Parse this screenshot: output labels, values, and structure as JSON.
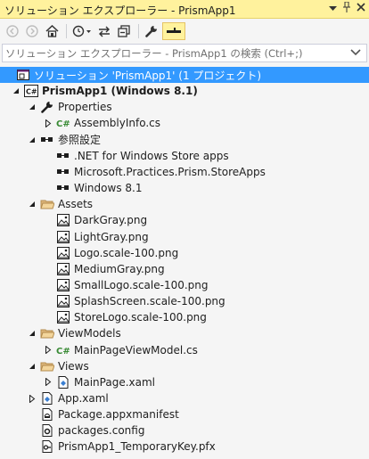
{
  "window": {
    "title": "ソリューション エクスプローラー - PrismApp1",
    "controls": [
      "dropdown-icon",
      "pin-icon",
      "close-icon"
    ]
  },
  "toolbar": {
    "buttons": [
      {
        "name": "back-button",
        "icon": "back-icon",
        "enabled": false
      },
      {
        "name": "forward-button",
        "icon": "forward-icon",
        "enabled": false
      },
      {
        "name": "home-button",
        "icon": "home-icon",
        "enabled": true
      },
      {
        "name": "history-button",
        "icon": "history-icon",
        "enabled": true
      },
      {
        "name": "sync-button",
        "icon": "sync-icon",
        "enabled": true
      },
      {
        "name": "collapse-all-button",
        "icon": "collapse-icon",
        "enabled": true
      },
      {
        "name": "properties-button",
        "icon": "wrench-icon",
        "enabled": true
      },
      {
        "name": "preview-button",
        "icon": "preview-icon",
        "enabled": true,
        "active": true
      }
    ]
  },
  "search": {
    "placeholder": "ソリューション エクスプローラー - PrismApp1 の検索 (Ctrl+;)"
  },
  "tree": [
    {
      "label": "ソリューション 'PrismApp1' (1 プロジェクト)",
      "icon": "solution-icon",
      "level": 0,
      "expander": "none",
      "selected": true
    },
    {
      "label": "PrismApp1 (Windows 8.1)",
      "icon": "csharp-project-icon",
      "level": 1,
      "expander": "open",
      "bold": true
    },
    {
      "label": "Properties",
      "icon": "wrench-icon",
      "level": 2,
      "expander": "open"
    },
    {
      "label": "AssemblyInfo.cs",
      "icon": "csharp-file-icon",
      "level": 3,
      "expander": "closed"
    },
    {
      "label": "参照設定",
      "icon": "references-icon",
      "level": 2,
      "expander": "open"
    },
    {
      "label": ".NET for Windows Store apps",
      "icon": "reference-icon",
      "level": 3,
      "expander": "none"
    },
    {
      "label": "Microsoft.Practices.Prism.StoreApps",
      "icon": "reference-icon",
      "level": 3,
      "expander": "none"
    },
    {
      "label": "Windows 8.1",
      "icon": "reference-icon",
      "level": 3,
      "expander": "none"
    },
    {
      "label": "Assets",
      "icon": "folder-open-icon",
      "level": 2,
      "expander": "open"
    },
    {
      "label": "DarkGray.png",
      "icon": "image-file-icon",
      "level": 3,
      "expander": "none"
    },
    {
      "label": "LightGray.png",
      "icon": "image-file-icon",
      "level": 3,
      "expander": "none"
    },
    {
      "label": "Logo.scale-100.png",
      "icon": "image-file-icon",
      "level": 3,
      "expander": "none"
    },
    {
      "label": "MediumGray.png",
      "icon": "image-file-icon",
      "level": 3,
      "expander": "none"
    },
    {
      "label": "SmallLogo.scale-100.png",
      "icon": "image-file-icon",
      "level": 3,
      "expander": "none"
    },
    {
      "label": "SplashScreen.scale-100.png",
      "icon": "image-file-icon",
      "level": 3,
      "expander": "none"
    },
    {
      "label": "StoreLogo.scale-100.png",
      "icon": "image-file-icon",
      "level": 3,
      "expander": "none"
    },
    {
      "label": "ViewModels",
      "icon": "folder-open-icon",
      "level": 2,
      "expander": "open"
    },
    {
      "label": "MainPageViewModel.cs",
      "icon": "csharp-file-icon",
      "level": 3,
      "expander": "closed"
    },
    {
      "label": "Views",
      "icon": "folder-open-icon",
      "level": 2,
      "expander": "open"
    },
    {
      "label": "MainPage.xaml",
      "icon": "xaml-file-icon",
      "level": 3,
      "expander": "closed"
    },
    {
      "label": "App.xaml",
      "icon": "xaml-file-icon",
      "level": 2,
      "expander": "closed"
    },
    {
      "label": "Package.appxmanifest",
      "icon": "manifest-file-icon",
      "level": 2,
      "expander": "none"
    },
    {
      "label": "packages.config",
      "icon": "config-file-icon",
      "level": 2,
      "expander": "none"
    },
    {
      "label": "PrismApp1_TemporaryKey.pfx",
      "icon": "key-file-icon",
      "level": 2,
      "expander": "none"
    }
  ],
  "colors": {
    "title_bg": "#fff29d",
    "selection": "#3399ff",
    "folder": "#dcb67a",
    "csharp": "#388a34"
  }
}
